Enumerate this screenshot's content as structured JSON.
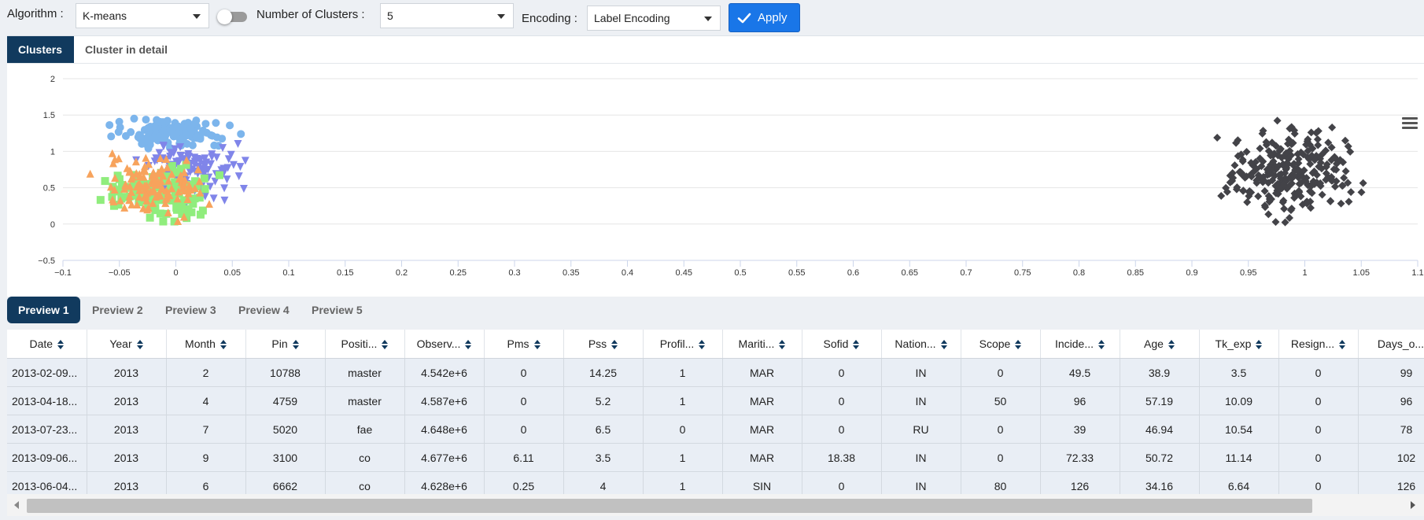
{
  "toolbar": {
    "algorithm_label": "Algorithm :",
    "algorithm_value": "K-means",
    "clusters_label": "Number of Clusters :",
    "clusters_value": "5",
    "encoding_label": "Encoding :",
    "encoding_value": "Label Encoding",
    "apply_label": "Apply",
    "toggle_on": false
  },
  "chart_tabs": [
    {
      "label": "Clusters",
      "active": true
    },
    {
      "label": "Cluster in detail",
      "active": false
    }
  ],
  "chart_data": {
    "type": "scatter",
    "xlim": [
      -0.1,
      1.1
    ],
    "ylim": [
      -0.5,
      2
    ],
    "x_ticks": [
      "−0.1",
      "−0.05",
      "0",
      "0.05",
      "0.1",
      "0.15",
      "0.2",
      "0.25",
      "0.3",
      "0.35",
      "0.4",
      "0.45",
      "0.5",
      "0.55",
      "0.6",
      "0.65",
      "0.7",
      "0.75",
      "0.8",
      "0.85",
      "0.9",
      "0.95",
      "1",
      "1.05",
      "1.1"
    ],
    "y_ticks": [
      "−0.5",
      "0",
      "0.5",
      "1",
      "1.5",
      "2"
    ],
    "grid": true,
    "series": [
      {
        "marker": "circle",
        "color": "#7cb5ec",
        "x_range": [
          -0.075,
          0.065
        ],
        "y_range": [
          1.0,
          1.5
        ],
        "count": 130
      },
      {
        "marker": "triangle-down",
        "color": "#8085e9",
        "x_range": [
          -0.05,
          0.075
        ],
        "y_range": [
          0.25,
          1.3
        ],
        "count": 110
      },
      {
        "marker": "square",
        "color": "#90ed7d",
        "x_range": [
          -0.075,
          0.05
        ],
        "y_range": [
          -0.12,
          0.95
        ],
        "count": 110
      },
      {
        "marker": "triangle",
        "color": "#f7a35c",
        "x_range": [
          -0.088,
          0.04
        ],
        "y_range": [
          -0.05,
          1.05
        ],
        "count": 120
      },
      {
        "marker": "diamond",
        "color": "#434348",
        "x_range": [
          0.91,
          1.065
        ],
        "y_range": [
          -0.1,
          1.55
        ],
        "count": 260
      }
    ]
  },
  "preview_tabs": [
    {
      "label": "Preview 1",
      "active": true
    },
    {
      "label": "Preview 2",
      "active": false
    },
    {
      "label": "Preview 3",
      "active": false
    },
    {
      "label": "Preview 4",
      "active": false
    },
    {
      "label": "Preview 5",
      "active": false
    }
  ],
  "table": {
    "columns": [
      "Date",
      "Year",
      "Month",
      "Pin",
      "Positi...",
      "Observ...",
      "Pms",
      "Pss",
      "Profil...",
      "Mariti...",
      "Sofid",
      "Nation...",
      "Scope",
      "Incide...",
      "Age",
      "Tk_exp",
      "Resign...",
      "Days_o..."
    ],
    "rows": [
      [
        "2013-02-09...",
        "2013",
        "2",
        "10788",
        "master",
        "4.542e+6",
        "0",
        "14.25",
        "1",
        "MAR",
        "0",
        "IN",
        "0",
        "49.5",
        "38.9",
        "3.5",
        "0",
        "99"
      ],
      [
        "2013-04-18...",
        "2013",
        "4",
        "4759",
        "master",
        "4.587e+6",
        "0",
        "5.2",
        "1",
        "MAR",
        "0",
        "IN",
        "50",
        "96",
        "57.19",
        "10.09",
        "0",
        "96"
      ],
      [
        "2013-07-23...",
        "2013",
        "7",
        "5020",
        "fae",
        "4.648e+6",
        "0",
        "6.5",
        "0",
        "MAR",
        "0",
        "RU",
        "0",
        "39",
        "46.94",
        "10.54",
        "0",
        "78"
      ],
      [
        "2013-09-06...",
        "2013",
        "9",
        "3100",
        "co",
        "4.677e+6",
        "6.11",
        "3.5",
        "1",
        "MAR",
        "18.38",
        "IN",
        "0",
        "72.33",
        "50.72",
        "11.14",
        "0",
        "102"
      ],
      [
        "2013-06-04...",
        "2013",
        "6",
        "6662",
        "co",
        "4.628e+6",
        "0.25",
        "4",
        "1",
        "SIN",
        "0",
        "IN",
        "80",
        "126",
        "34.16",
        "6.64",
        "0",
        "126"
      ],
      [
        "",
        "",
        "",
        "",
        "",
        "",
        "",
        "",
        "",
        "",
        "",
        "",
        "",
        "",
        "",
        "",
        "",
        ""
      ]
    ]
  }
}
